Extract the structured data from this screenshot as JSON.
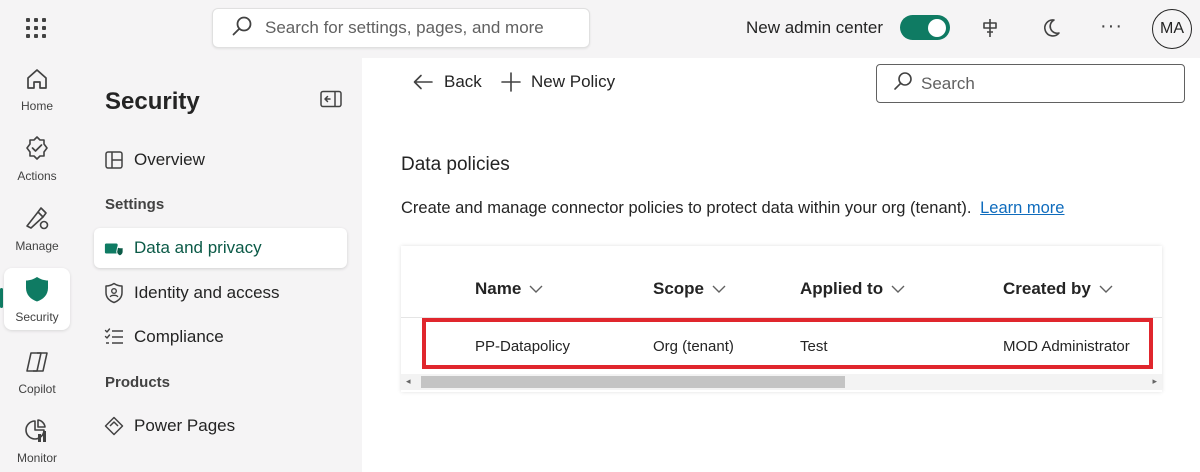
{
  "topbar": {
    "search_placeholder": "Search for settings, pages, and more",
    "admin_toggle_label": "New admin center",
    "admin_toggle_on": true,
    "more_label": "···",
    "avatar_initials": "MA"
  },
  "rail": {
    "items": [
      {
        "label": "Home",
        "icon": "home-icon"
      },
      {
        "label": "Actions",
        "icon": "actions-icon"
      },
      {
        "label": "Manage",
        "icon": "manage-icon"
      },
      {
        "label": "Security",
        "icon": "shield-icon",
        "active": true
      },
      {
        "label": "Copilot",
        "icon": "copilot-icon"
      },
      {
        "label": "Monitor",
        "icon": "monitor-icon"
      }
    ]
  },
  "nav": {
    "title": "Security",
    "overview": "Overview",
    "settings_section": "Settings",
    "data_privacy": "Data and privacy",
    "identity_access": "Identity and access",
    "compliance": "Compliance",
    "products_section": "Products",
    "power_pages": "Power Pages"
  },
  "main": {
    "back_label": "Back",
    "new_policy_label": "New Policy",
    "search_placeholder": "Search",
    "heading": "Data policies",
    "description": "Create and manage connector policies to protect data within your org (tenant).",
    "learn_more": "Learn more",
    "columns": [
      "Name",
      "Scope",
      "Applied to",
      "Created by"
    ],
    "rows": [
      {
        "name": "PP-Datapolicy",
        "scope": "Org (tenant)",
        "applied_to": "Test",
        "created_by": "MOD Administrator"
      }
    ]
  },
  "colors": {
    "accent": "#0f7b63",
    "highlight_border": "#e0262d",
    "link": "#0f6cbd"
  }
}
